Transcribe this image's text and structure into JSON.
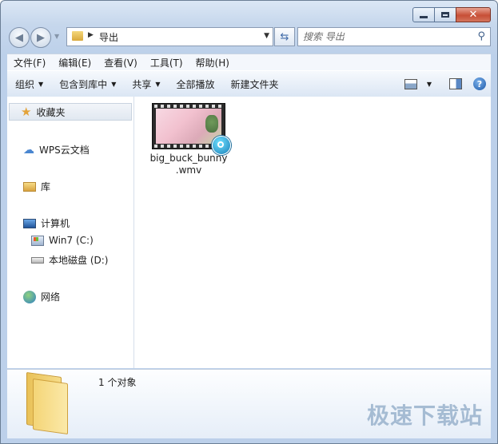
{
  "window": {
    "minimize_label": "–",
    "close_label": "✕"
  },
  "nav": {
    "back_icon": "arrow-left-icon",
    "forward_icon": "arrow-right-icon",
    "breadcrumb": "导出",
    "search_placeholder": "搜索 导出"
  },
  "menu": {
    "file": "文件(F)",
    "edit": "编辑(E)",
    "view": "查看(V)",
    "tools": "工具(T)",
    "help": "帮助(H)"
  },
  "toolbar": {
    "organize": "组织",
    "include_in_library": "包含到库中",
    "share": "共享",
    "play_all": "全部播放",
    "new_folder": "新建文件夹"
  },
  "sidebar": {
    "favorites": "收藏夹",
    "wps_cloud": "WPS云文档",
    "libraries": "库",
    "computer": "计算机",
    "drive_c": "Win7 (C:)",
    "drive_d": "本地磁盘 (D:)",
    "network": "网络"
  },
  "files": [
    {
      "name": "big_buck_bunny.wmv",
      "display_line1": "big_buck_bunny",
      "display_line2": ".wmv"
    }
  ],
  "details": {
    "count_text": "1 个对象"
  },
  "watermark": {
    "text": "极速下载站"
  }
}
